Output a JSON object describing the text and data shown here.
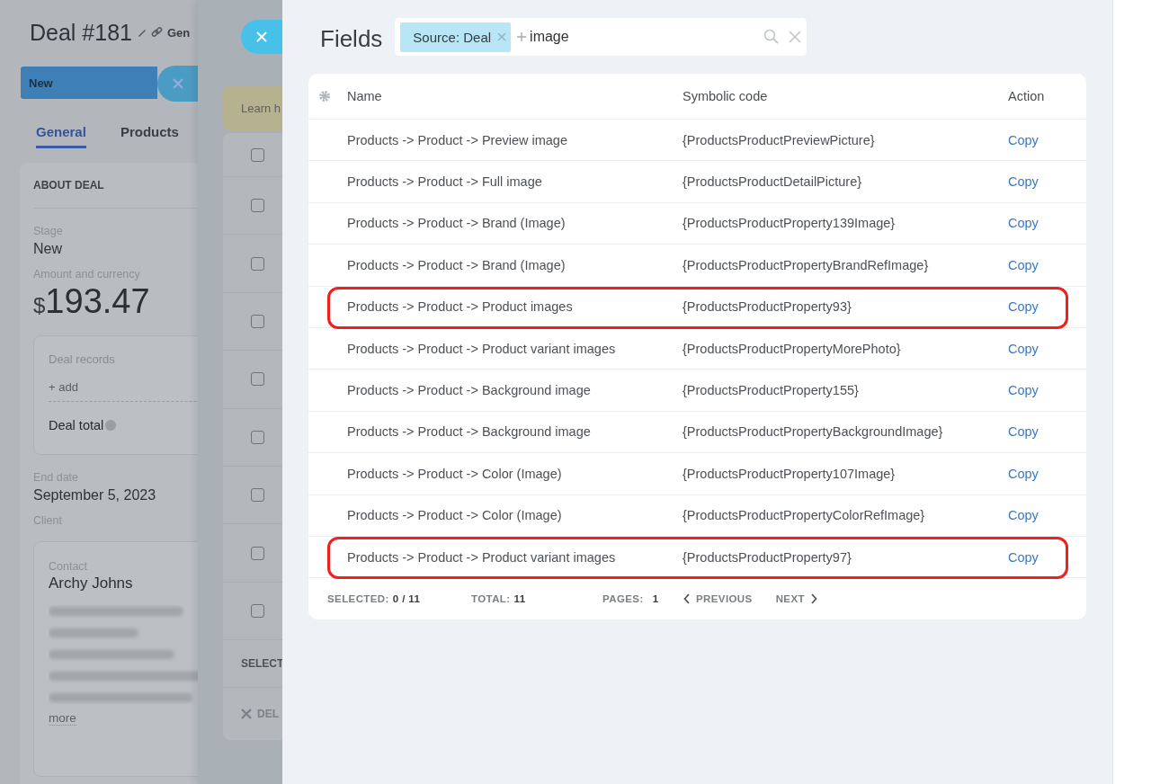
{
  "deal_page": {
    "title": "Deal #181",
    "category": "Gen",
    "stage_bar": {
      "label": "New"
    },
    "tabs": [
      {
        "label": "General",
        "selected": true
      },
      {
        "label": "Products",
        "selected": false
      }
    ],
    "section_title": "ABOUT DEAL",
    "stage": {
      "label": "Stage",
      "value": "New"
    },
    "amount": {
      "label": "Amount and currency",
      "currency": "$",
      "value": "193.47"
    },
    "deal_records": {
      "title": "Deal records",
      "add_link": "+ add",
      "total_label": "Deal total"
    },
    "end_date": {
      "label": "End date",
      "value": "September 5, 2023"
    },
    "client": {
      "label": "Client",
      "contact_label": "Contact",
      "contact_name": "Archy Johns",
      "more_link": "more"
    }
  },
  "list_panel": {
    "notice": "Learn h",
    "rows": [
      {
        "checked": false
      },
      {
        "checked": false
      },
      {
        "checked": false
      },
      {
        "checked": false
      },
      {
        "checked": false
      },
      {
        "checked": false
      },
      {
        "checked": false
      },
      {
        "checked": false
      },
      {
        "checked": false
      }
    ],
    "footer_label": "SELECT",
    "delete_button": "DEL"
  },
  "fields_panel": {
    "title": "Fields",
    "search": {
      "tag": "Source: Deal",
      "value": "image"
    },
    "columns": [
      "Name",
      "Symbolic code",
      "Action"
    ],
    "rows": [
      {
        "name": "Products -> Product -> Preview image",
        "code": "{ProductsProductPreviewPicture}",
        "action": "Copy",
        "highlighted": false
      },
      {
        "name": "Products -> Product -> Full image",
        "code": "{ProductsProductDetailPicture}",
        "action": "Copy",
        "highlighted": false
      },
      {
        "name": "Products -> Product -> Brand (Image)",
        "code": "{ProductsProductProperty139Image}",
        "action": "Copy",
        "highlighted": false
      },
      {
        "name": "Products -> Product -> Brand (Image)",
        "code": "{ProductsProductPropertyBrandRefImage}",
        "action": "Copy",
        "highlighted": false
      },
      {
        "name": "Products -> Product -> Product images",
        "code": "{ProductsProductProperty93}",
        "action": "Copy",
        "highlighted": true
      },
      {
        "name": "Products -> Product -> Product variant images",
        "code": "{ProductsProductPropertyMorePhoto}",
        "action": "Copy",
        "highlighted": false
      },
      {
        "name": "Products -> Product -> Background image",
        "code": "{ProductsProductProperty155}",
        "action": "Copy",
        "highlighted": false
      },
      {
        "name": "Products -> Product -> Background image",
        "code": "{ProductsProductPropertyBackgroundImage}",
        "action": "Copy",
        "highlighted": false
      },
      {
        "name": "Products -> Product -> Color (Image)",
        "code": "{ProductsProductProperty107Image}",
        "action": "Copy",
        "highlighted": false
      },
      {
        "name": "Products -> Product -> Color (Image)",
        "code": "{ProductsProductPropertyColorRefImage}",
        "action": "Copy",
        "highlighted": false
      },
      {
        "name": "Products -> Product -> Product variant images",
        "code": "{ProductsProductProperty97}",
        "action": "Copy",
        "highlighted": true
      }
    ],
    "footer": {
      "selected_label": "SELECTED:",
      "selected_value": "0 / 11",
      "total_label": "TOTAL:",
      "total_value": "11",
      "pages_label": "PAGES:",
      "pages_value": "1",
      "previous": "PREVIOUS",
      "next": "NEXT"
    }
  }
}
